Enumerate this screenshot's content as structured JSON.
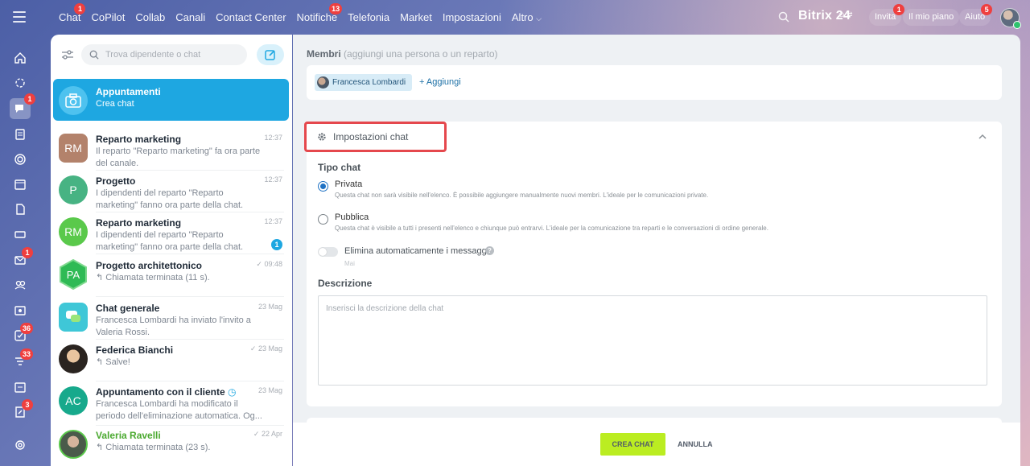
{
  "topbar": {
    "nav": [
      {
        "label": "Chat",
        "badge": "1"
      },
      {
        "label": "CoPilot",
        "badge": ""
      },
      {
        "label": "Collab",
        "badge": ""
      },
      {
        "label": "Canali",
        "badge": ""
      },
      {
        "label": "Contact Center",
        "badge": ""
      },
      {
        "label": "Notifiche",
        "badge": "13"
      },
      {
        "label": "Telefonia",
        "badge": ""
      },
      {
        "label": "Market",
        "badge": ""
      },
      {
        "label": "Impostazioni",
        "badge": ""
      },
      {
        "label": "Altro",
        "badge": ""
      }
    ],
    "brand": "Bitrix 24",
    "invite_label": "Invita",
    "invite_badge": "1",
    "plan_label": "Il mio piano",
    "help_label": "Aiuto",
    "help_badge": "5"
  },
  "rail": {
    "chat_badge": "1",
    "mail_badge": "1",
    "tasks_badge": "36",
    "feed_badge": "33",
    "form_badge": "3"
  },
  "chatlist": {
    "search_placeholder": "Trova dipendente o chat",
    "items": [
      {
        "title": "Appuntamenti",
        "sub": "Crea chat",
        "time": "",
        "initials": ""
      },
      {
        "title": "Reparto marketing",
        "sub": "Il reparto \"Reparto marketing\" fa ora parte del canale.",
        "time": "12:37",
        "initials": "RM"
      },
      {
        "title": "Progetto",
        "sub": "I dipendenti del reparto \"Reparto marketing\" fanno ora parte della chat.",
        "time": "12:37",
        "initials": "P"
      },
      {
        "title": "Reparto marketing",
        "sub": "I dipendenti del reparto \"Reparto marketing\" fanno ora parte della chat.",
        "time": "12:37",
        "initials": "RM",
        "unread": "1"
      },
      {
        "title": "Progetto architettonico",
        "sub": "↰ Chiamata terminata (11 s).",
        "time": "09:48",
        "initials": "PA"
      },
      {
        "title": "Chat generale",
        "sub": "Francesca Lombardi ha inviato l'invito a Valeria Rossi.",
        "time": "23 Mag",
        "initials": ""
      },
      {
        "title": "Federica Bianchi",
        "sub": "↰ Salve!",
        "time": "23 Mag",
        "initials": ""
      },
      {
        "title": "Appuntamento con il cliente",
        "sub": "Francesca Lombardi ha modificato il periodo dell'eliminazione automatica. Og...",
        "time": "23 Mag",
        "initials": "AC"
      },
      {
        "title": "Valeria Ravelli",
        "sub": "↰ Chiamata terminata (23 s).",
        "time": "22 Apr",
        "initials": ""
      }
    ]
  },
  "main": {
    "members_label": "Membri",
    "members_hint": "(aggiungi una persona o un reparto)",
    "member_name": "Francesca Lombardi",
    "add_label": "+ Aggiungi",
    "settings_title": "Impostazioni chat",
    "tipo_label": "Tipo chat",
    "private_label": "Privata",
    "private_desc": "Questa chat non sarà visibile nell'elenco. È possibile aggiungere manualmente nuovi membri. L'ideale per le comunicazioni private.",
    "public_label": "Pubblica",
    "public_desc": "Questa chat è visibile a tutti i presenti nell'elenco e chiunque può entrarvi. L'ideale per la comunicazione tra reparti e le conversazioni di ordine generale.",
    "autodelete_label": "Elimina automaticamente i messaggi",
    "autodelete_value": "Mai",
    "desc_label": "Descrizione",
    "desc_placeholder": "Inserisci la descrizione della chat",
    "create_label": "CREA CHAT",
    "cancel_label": "ANNULLA"
  },
  "colors": {
    "accent": "#1ea7e1",
    "create_button": "#bbed21",
    "highlight_border": "#e5484d"
  }
}
